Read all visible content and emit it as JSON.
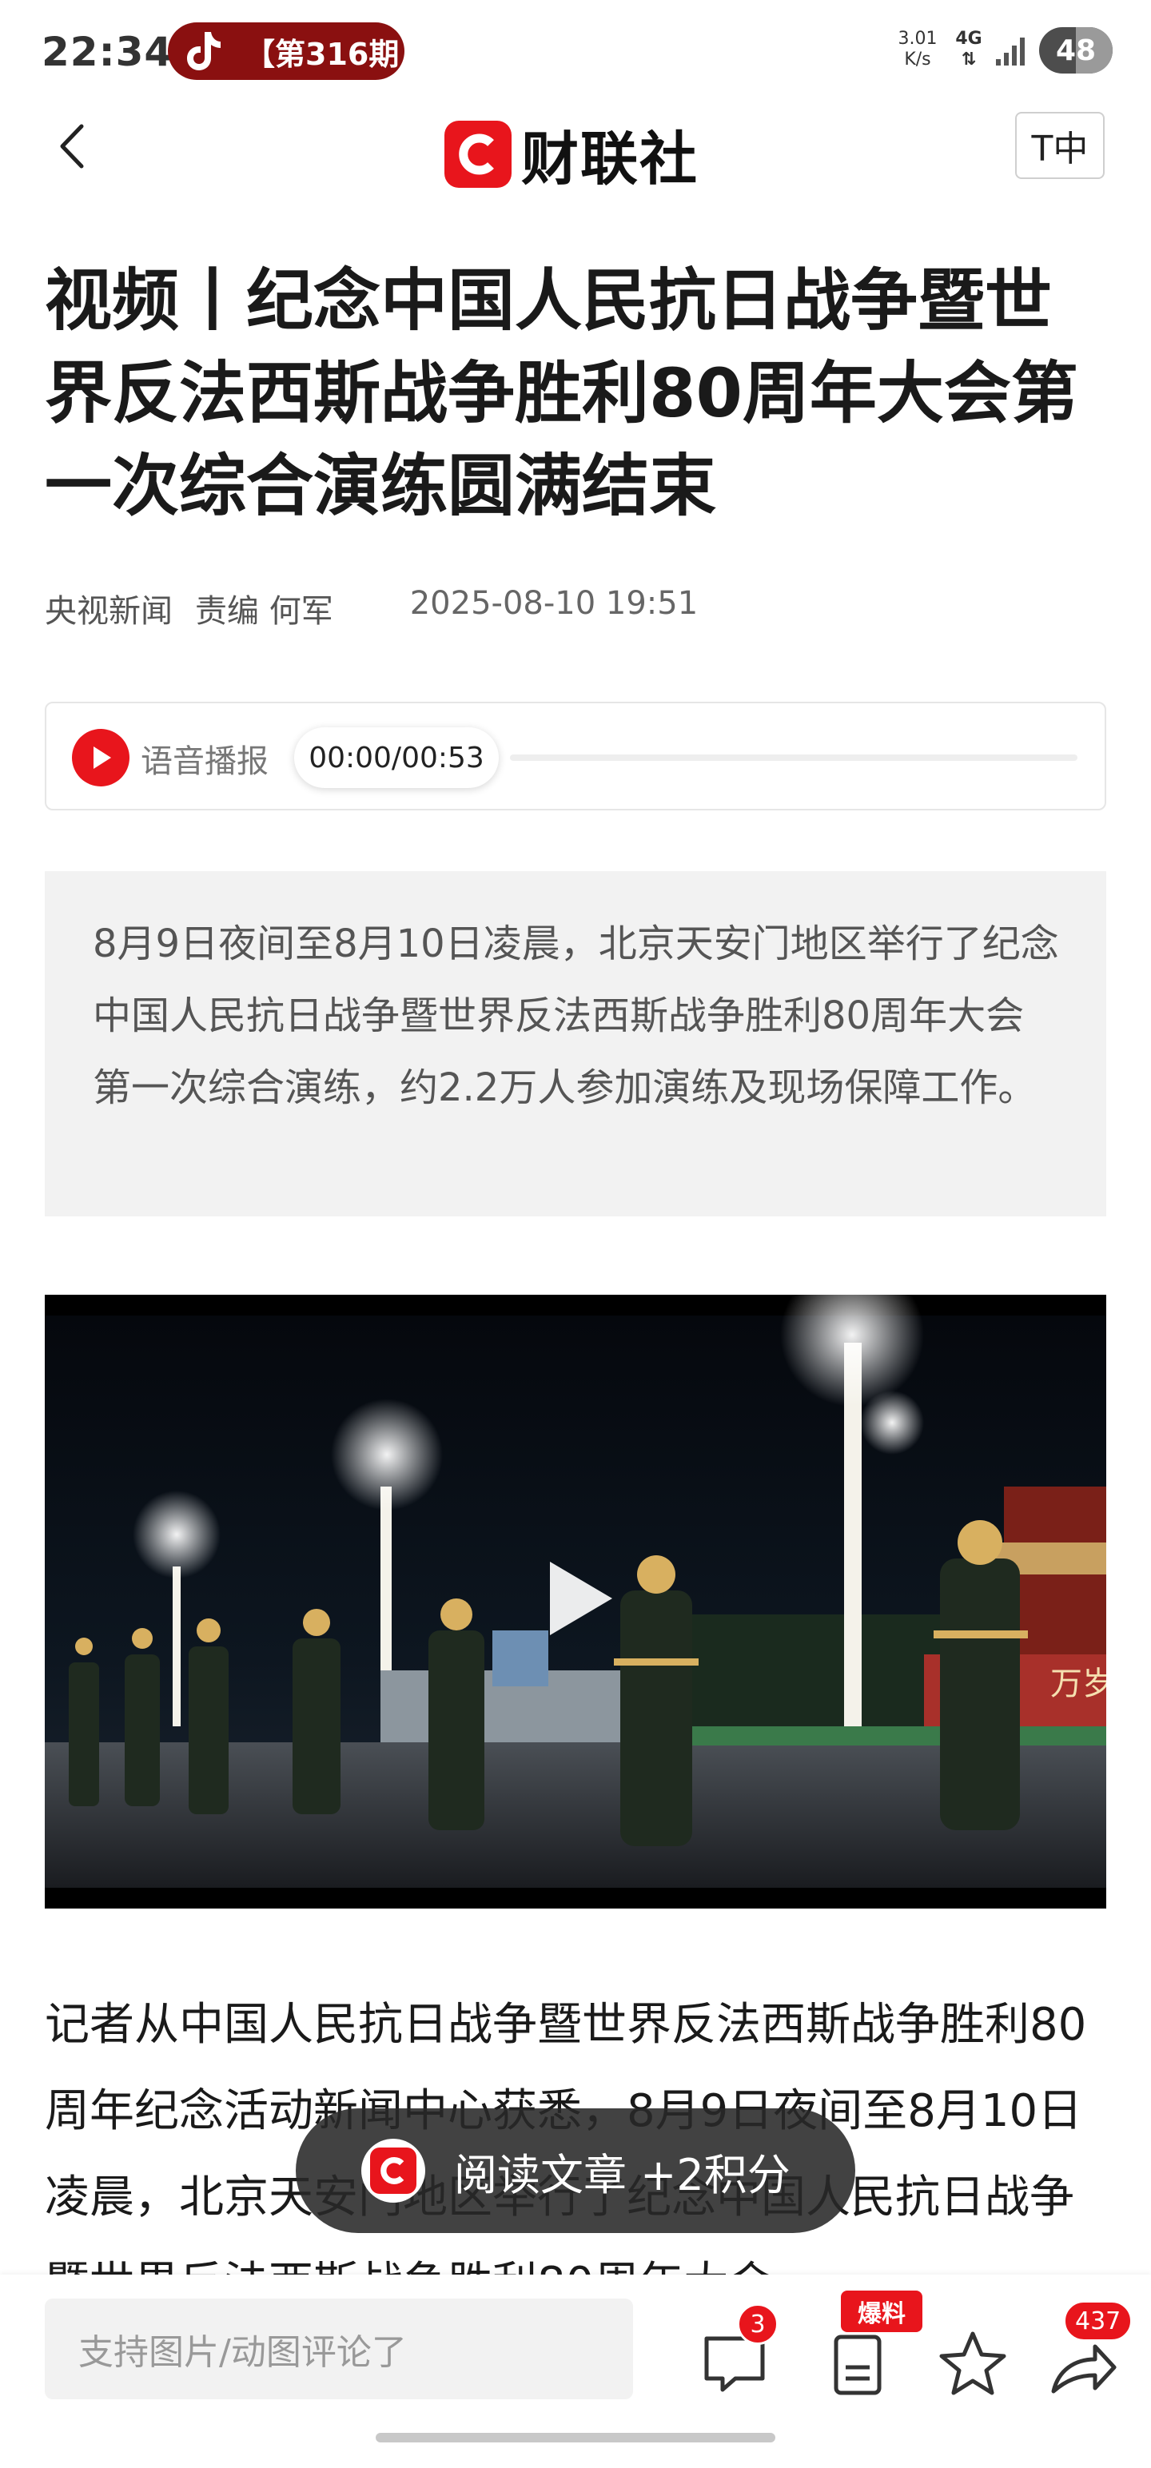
{
  "status_bar": {
    "time": "22:34",
    "notification": "【第316期",
    "net_speed_value": "3.01",
    "net_speed_unit": "K/s",
    "network": "4G",
    "battery": "48"
  },
  "nav": {
    "logo_text": "财联社",
    "font_size_button": "T中"
  },
  "article": {
    "title": "视频丨纪念中国人民抗日战争暨世界反法西斯战争胜利80周年大会第一次综合演练圆满结束",
    "source": "央视新闻",
    "editor": "责编  何军",
    "date": "2025-08-10 19:51",
    "summary": "8月9日夜间至8月10日凌晨，北京天安门地区举行了纪念中国人民抗日战争暨世界反法西斯战争胜利80周年大会第一次综合演练，约2.2万人参加演练及现场保障工作。",
    "body": "记者从中国人民抗日战争暨世界反法西斯战争胜利80周年纪念活动新闻中心获悉，8月9日夜间至8月10日凌晨，北京天安门地区举行了纪念中国人民抗日战争暨世界反法西斯战争胜利80周年大会"
  },
  "audio": {
    "label": "语音播报",
    "time": "00:00/00:53",
    "progress": 0
  },
  "video": {
    "banner_text": "万岁"
  },
  "toast": {
    "text": "阅读文章 +2积分"
  },
  "bottom_bar": {
    "comment_placeholder": "支持图片/动图评论了",
    "comment_count": "3",
    "tip_label": "爆料",
    "share_count": "437"
  },
  "colors": {
    "brand_red": "#e8151c",
    "summary_bg": "#f2f2f2"
  }
}
